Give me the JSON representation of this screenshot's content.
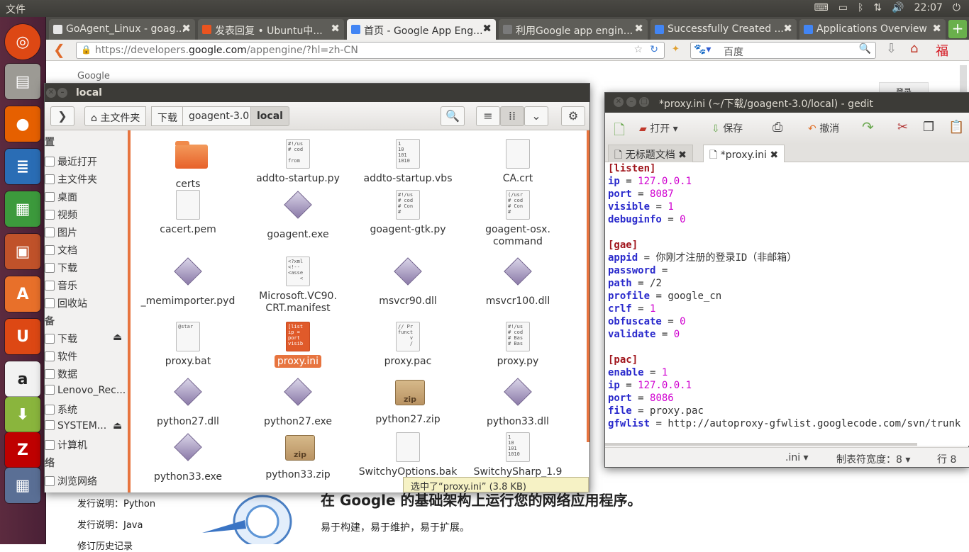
{
  "top_panel": {
    "menu": "文件",
    "time": "22:07"
  },
  "launcher": {
    "icons": [
      "ubuntu-dash",
      "files",
      "firefox",
      "writer",
      "calc",
      "impress",
      "software-center",
      "ubuntu-one",
      "amazon",
      "updates",
      "filezilla",
      "workspace"
    ]
  },
  "browser": {
    "tabs": [
      {
        "label": "GoAgent_Linux - goag...",
        "fav": "#e6e6e6"
      },
      {
        "label": "发表回复 • Ubuntu中...",
        "fav": "#e95420"
      },
      {
        "label": "首页 - Google App Eng...",
        "fav": "#4285f4"
      },
      {
        "label": "利用Google app engin...",
        "fav": "#7a7a7a"
      },
      {
        "label": "Successfully Created ...",
        "fav": "#4285f4"
      },
      {
        "label": "Applications Overview",
        "fav": "#4285f4"
      }
    ],
    "url_prefix": "https://developers.",
    "url_domain": "google.com",
    "url_suffix": "/appengine/?hl=zh-CN",
    "search_placeholder": "百度"
  },
  "page": {
    "logo_text": "Google",
    "login": "登录",
    "sidebar_links": [
      "发行说明：Python",
      "发行说明：Java",
      "修订历史记录"
    ],
    "headline": "在 Google 的基础架构上运行您的网络应用程序。",
    "subline": "易于构建，易于维护，易于扩展。"
  },
  "file_manager": {
    "title": "local",
    "breadcrumbs": [
      "主文件夹",
      "下载",
      "goagent-3.0",
      "local"
    ],
    "sidebar": {
      "header_places": "置",
      "places": [
        "最近打开",
        "主文件夹",
        "桌面",
        "视频",
        "图片",
        "文档",
        "下载",
        "音乐",
        "回收站"
      ],
      "header_devices": "备",
      "devices": [
        "下载",
        "软件",
        "数据",
        "Lenovo_Rec...",
        "系统",
        "SYSTEM...",
        "计算机"
      ],
      "header_network": "络",
      "network": [
        "浏览网络"
      ]
    },
    "files": [
      {
        "name": "certs",
        "kind": "folder",
        "preview": ""
      },
      {
        "name": "addto-startup.py",
        "kind": "doc",
        "preview": "#!/us\n# cod\n\nfrom"
      },
      {
        "name": "addto-startup.vbs",
        "kind": "doc",
        "preview": "1\n10\n101\n1010"
      },
      {
        "name": "CA.crt",
        "kind": "doc",
        "preview": ""
      },
      {
        "name": "cacert.pem",
        "kind": "doc",
        "preview": ""
      },
      {
        "name": "goagent.exe",
        "kind": "diamond",
        "preview": ""
      },
      {
        "name": "goagent-gtk.py",
        "kind": "doc",
        "preview": "#!/us\n# cod\n# Con\n#"
      },
      {
        "name": "goagent-osx.\ncommand",
        "kind": "doc",
        "preview": "(/usr\n# cod\n# Con\n#"
      },
      {
        "name": "_memimporter.pyd",
        "kind": "diamond",
        "preview": ""
      },
      {
        "name": "Microsoft.VC90.\nCRT.manifest",
        "kind": "doc",
        "preview": "<?xml\n<!--\n<asse\n    <"
      },
      {
        "name": "msvcr90.dll",
        "kind": "diamond",
        "preview": ""
      },
      {
        "name": "msvcr100.dll",
        "kind": "diamond",
        "preview": ""
      },
      {
        "name": "proxy.bat",
        "kind": "doc",
        "preview": "@star"
      },
      {
        "name": "proxy.ini",
        "kind": "selected",
        "preview": "[list\nip =\nport\nvisib"
      },
      {
        "name": "proxy.pac",
        "kind": "doc",
        "preview": "// Pr\nfunct\n    v\n    /"
      },
      {
        "name": "proxy.py",
        "kind": "doc",
        "preview": "#!/us\n# cod\n# Bas\n# Bas"
      },
      {
        "name": "python27.dll",
        "kind": "diamond",
        "preview": ""
      },
      {
        "name": "python27.exe",
        "kind": "diamond",
        "preview": ""
      },
      {
        "name": "python27.zip",
        "kind": "zip",
        "preview": "zip"
      },
      {
        "name": "python33.dll",
        "kind": "diamond",
        "preview": ""
      },
      {
        "name": "python33.exe",
        "kind": "diamond",
        "preview": ""
      },
      {
        "name": "python33.zip",
        "kind": "zip",
        "preview": "zip"
      },
      {
        "name": "SwitchyOptions.bak",
        "kind": "doc",
        "preview": ""
      },
      {
        "name": "SwitchySharp_1.9",
        "kind": "doc",
        "preview": "1\n10\n101\n1010"
      }
    ],
    "status": "选中了“proxy.ini” (3.8 KB)"
  },
  "gedit": {
    "title": "*proxy.ini (~/下载/goagent-3.0/local) - gedit",
    "toolbar": {
      "open": "打开",
      "save": "保存",
      "undo": "撤消"
    },
    "tabs": [
      "无标题文档",
      "*proxy.ini"
    ],
    "lines": [
      {
        "t": "sec",
        "s": "[listen]"
      },
      {
        "t": "kv",
        "k": "ip",
        "v": "127.0.0.1"
      },
      {
        "t": "kv",
        "k": "port",
        "v": "8087"
      },
      {
        "t": "kv",
        "k": "visible",
        "v": "1"
      },
      {
        "t": "kv",
        "k": "debuginfo",
        "v": "0"
      },
      {
        "t": "blank",
        "s": ""
      },
      {
        "t": "sec",
        "s": "[gae]"
      },
      {
        "t": "kvp",
        "k": "appid",
        "v": "你刚才注册的登录ID（非邮箱）"
      },
      {
        "t": "kvp",
        "k": "password",
        "v": ""
      },
      {
        "t": "kvp",
        "k": "path",
        "v": "/2"
      },
      {
        "t": "kvp",
        "k": "profile",
        "v": "google_cn"
      },
      {
        "t": "kv",
        "k": "crlf",
        "v": "1"
      },
      {
        "t": "kv",
        "k": "obfuscate",
        "v": "0"
      },
      {
        "t": "kv",
        "k": "validate",
        "v": "0"
      },
      {
        "t": "blank",
        "s": ""
      },
      {
        "t": "sec",
        "s": "[pac]"
      },
      {
        "t": "kv",
        "k": "enable",
        "v": "1"
      },
      {
        "t": "kv",
        "k": "ip",
        "v": "127.0.0.1"
      },
      {
        "t": "kv",
        "k": "port",
        "v": "8086"
      },
      {
        "t": "kvp",
        "k": "file",
        "v": "proxy.pac"
      },
      {
        "t": "kvp",
        "k": "gfwlist",
        "v": "http://autoproxy-gfwlist.googlecode.com/svn/trunk"
      }
    ],
    "status": {
      "lang": ".ini",
      "tab_width": "制表符宽度：8",
      "pos": "行 8"
    }
  }
}
